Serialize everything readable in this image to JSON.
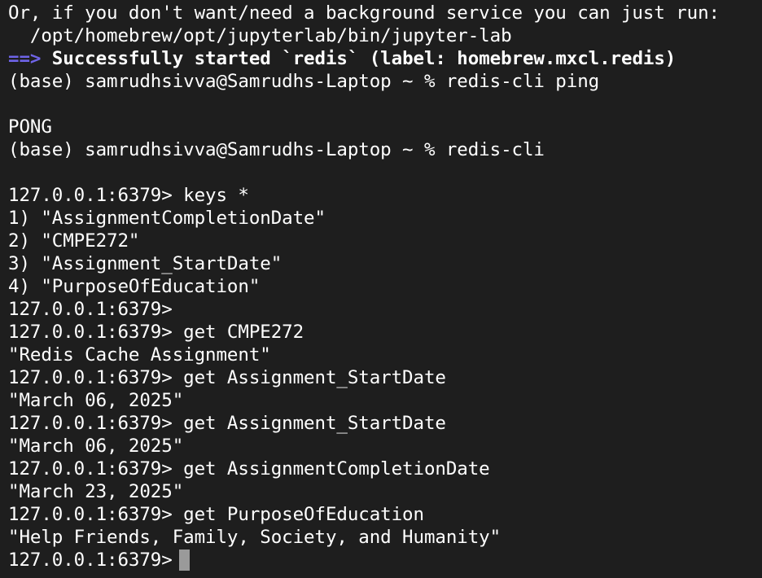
{
  "colors": {
    "background": "#1e1e1e",
    "text": "#ffffff",
    "arrow": "#6f64e8",
    "cursor": "#9a9a9a"
  },
  "terminal": {
    "lines": [
      "Or, if you don't want/need a background service you can just run:",
      "  /opt/homebrew/opt/jupyterlab/bin/jupyter-lab",
      {
        "arrow": "==>",
        "text": "Successfully started `redis` (label: homebrew.mxcl.redis)"
      },
      "(base) samrudhsivva@Samrudhs-Laptop ~ % redis-cli ping",
      "",
      "PONG",
      "(base) samrudhsivva@Samrudhs-Laptop ~ % redis-cli",
      "",
      "127.0.0.1:6379> keys *",
      "1) \"AssignmentCompletionDate\"",
      "2) \"CMPE272\"",
      "3) \"Assignment_StartDate\"",
      "4) \"PurposeOfEducation\"",
      "127.0.0.1:6379>",
      "127.0.0.1:6379> get CMPE272",
      "\"Redis Cache Assignment\"",
      "127.0.0.1:6379> get Assignment_StartDate",
      "\"March 06, 2025\"",
      "127.0.0.1:6379> get Assignment_StartDate",
      "\"March 06, 2025\"",
      "127.0.0.1:6379> get AssignmentCompletionDate",
      "\"March 23, 2025\"",
      "127.0.0.1:6379> get PurposeOfEducation",
      "\"Help Friends, Family, Society, and Humanity\""
    ],
    "prompt": "127.0.0.1:6379>"
  }
}
